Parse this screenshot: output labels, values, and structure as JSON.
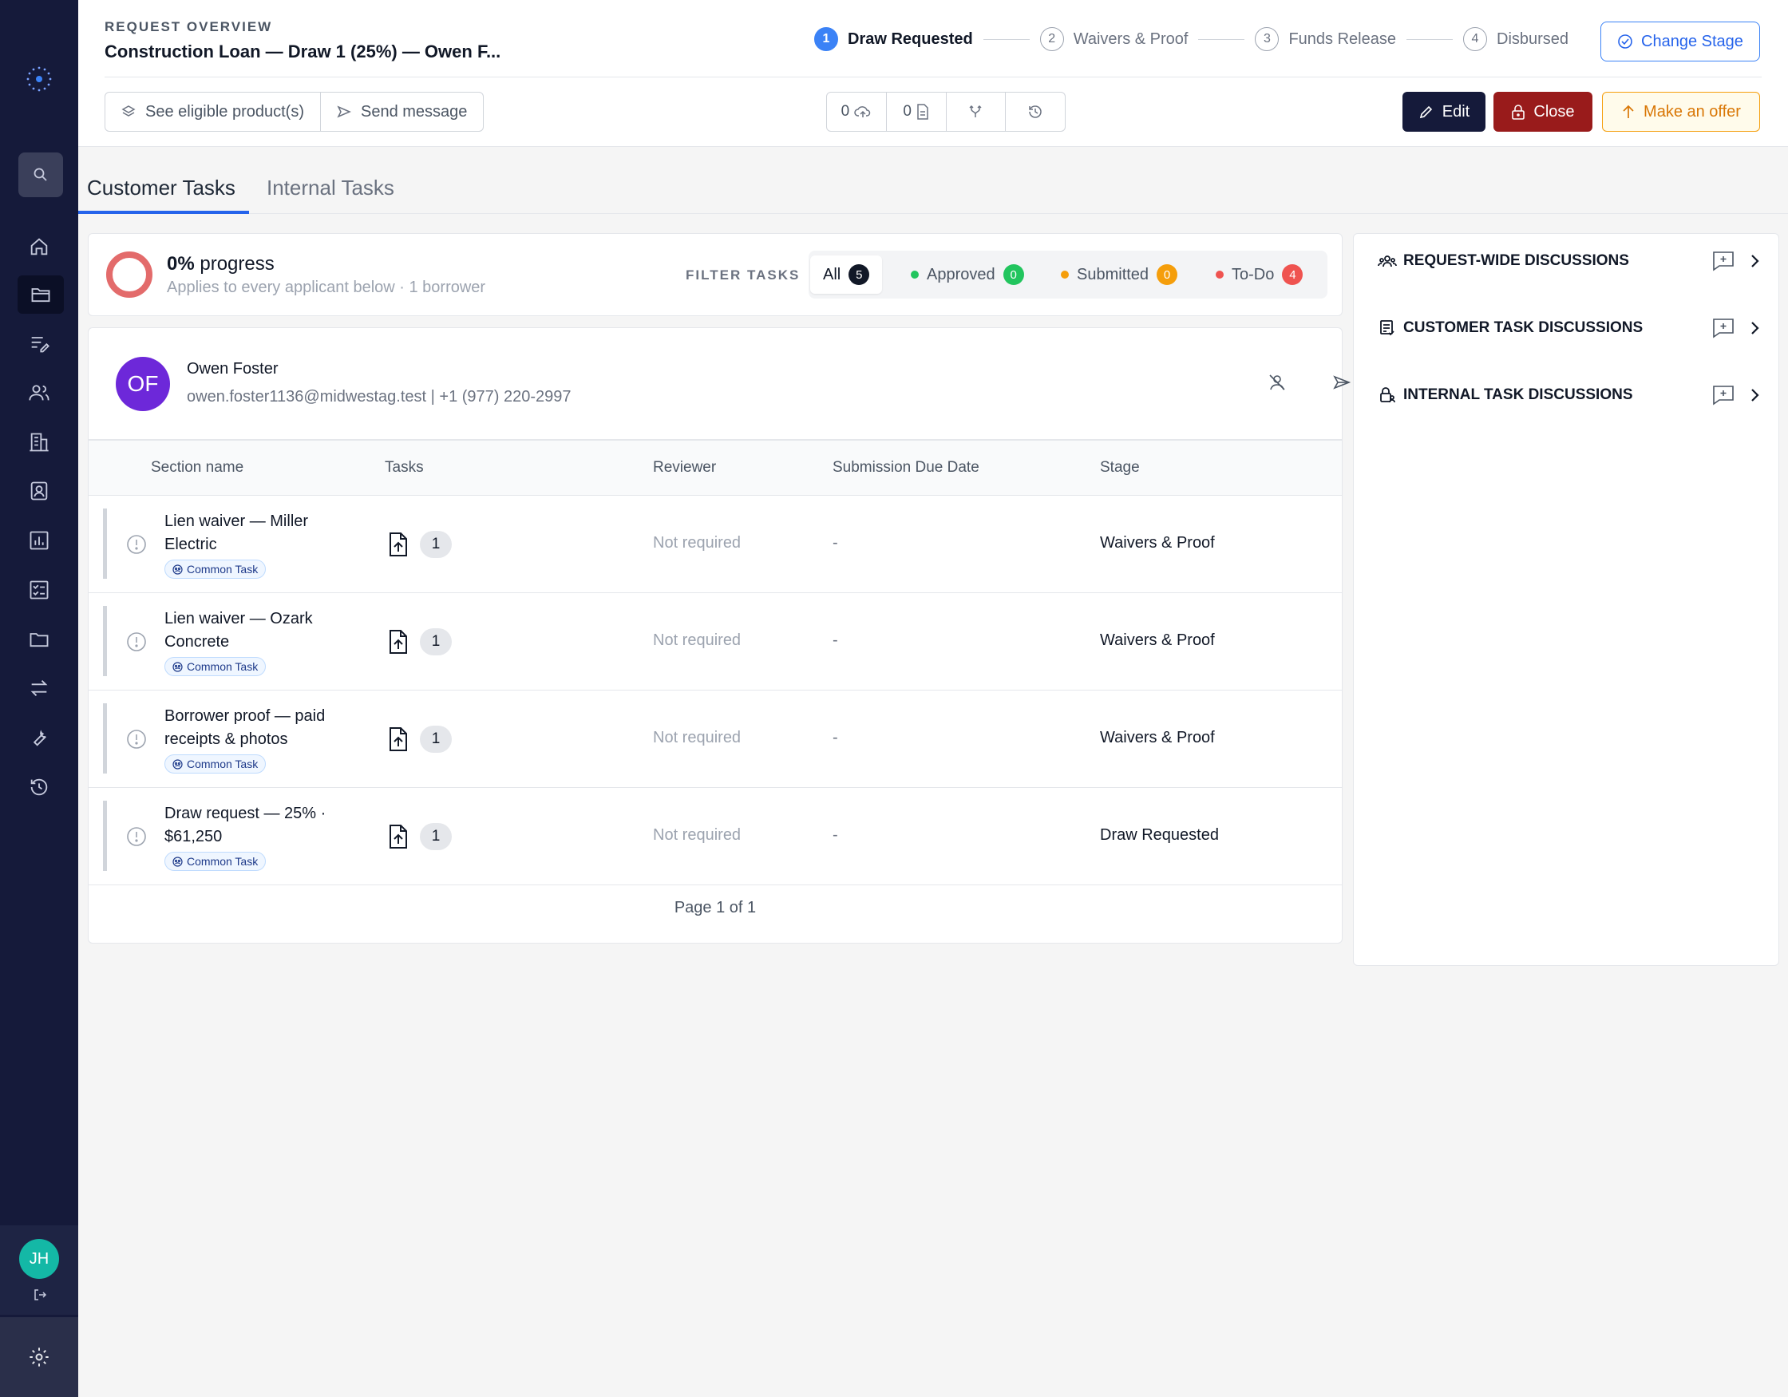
{
  "header": {
    "eyebrow": "REQUEST OVERVIEW",
    "title": "Construction Loan — Draw 1 (25%) — Owen F...",
    "change_stage_label": "Change Stage",
    "steps": [
      {
        "num": "1",
        "label": "Draw Requested",
        "active": true
      },
      {
        "num": "2",
        "label": "Waivers & Proof",
        "active": false
      },
      {
        "num": "3",
        "label": "Funds Release",
        "active": false
      },
      {
        "num": "4",
        "label": "Disbursed",
        "active": false
      }
    ],
    "see_products_label": "See eligible product(s)",
    "send_message_label": "Send message",
    "upload_count": "0",
    "document_count": "0",
    "edit_label": "Edit",
    "close_label": "Close",
    "offer_label": "Make an offer"
  },
  "sidebar": {
    "items": [
      "home-icon",
      "folder-open-icon",
      "notes-icon",
      "users-icon",
      "building-icon",
      "contact-card-icon",
      "bar-chart-icon",
      "checklist-icon",
      "folder-icon",
      "transfer-icon",
      "wrench-icon",
      "history-icon"
    ],
    "user_initials": "JH"
  },
  "tabs": {
    "customer": "Customer Tasks",
    "internal": "Internal Tasks"
  },
  "progress": {
    "percent_label": "0%",
    "suffix": "progress",
    "value": 0,
    "subtitle": "Applies to every applicant below · 1 borrower"
  },
  "filter": {
    "label": "FILTER TASKS",
    "all_label": "All",
    "all_count": "5",
    "approved_label": "Approved",
    "approved_count": "0",
    "submitted_label": "Submitted",
    "submitted_count": "0",
    "todo_label": "To-Do",
    "todo_count": "4"
  },
  "borrower": {
    "initials": "OF",
    "name": "Owen Foster",
    "contact": "owen.foster1136@midwestag.test | +1 (977) 220-2997"
  },
  "table": {
    "columns": [
      "Section name",
      "Tasks",
      "Reviewer",
      "Submission Due Date",
      "Stage"
    ],
    "tag_label": "Common Task",
    "rows": [
      {
        "name": "Lien waiver — Miller Electric",
        "tasks": "1",
        "reviewer": "Not required",
        "due": "-",
        "stage": "Waivers & Proof"
      },
      {
        "name": "Lien waiver — Ozark Concrete",
        "tasks": "1",
        "reviewer": "Not required",
        "due": "-",
        "stage": "Waivers & Proof"
      },
      {
        "name": "Borrower proof — paid receipts & photos",
        "tasks": "1",
        "reviewer": "Not required",
        "due": "-",
        "stage": "Waivers & Proof"
      },
      {
        "name": "Draw request — 25% · $61,250",
        "tasks": "1",
        "reviewer": "Not required",
        "due": "-",
        "stage": "Draw Requested"
      }
    ],
    "pager": "Page 1 of 1"
  },
  "discussions": {
    "request_wide": "REQUEST-WIDE DISCUSSIONS",
    "customer_task": "CUSTOMER TASK DISCUSSIONS",
    "internal_task": "INTERNAL TASK DISCUSSIONS"
  },
  "colors": {
    "sidebar": "#151a3a",
    "accent": "#3b82f6",
    "danger": "#991b1b",
    "warning": "#f59e0b",
    "approved": "#22c55e",
    "todo": "#ef5350",
    "avatar_borrower": "#6d28d9",
    "avatar_user": "#14b8a6"
  }
}
